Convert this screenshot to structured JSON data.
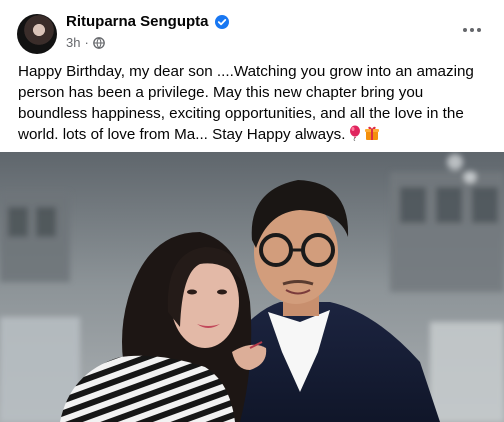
{
  "post": {
    "author": "Rituparna Sengupta",
    "time": "3h",
    "separator": "·",
    "verified": true,
    "icons": {
      "verified": "verified-badge-icon",
      "audience": "globe-icon",
      "more": "more-options-icon"
    },
    "text": "Happy Birthday, my dear son ....Watching you grow into an amazing person has been a privilege. May this new chapter bring you boundless happiness, exciting opportunities, and all the love in the world. lots of love from Ma... Stay Happy always.",
    "emojis": [
      "balloon",
      "gift"
    ],
    "photo": {
      "alt": "Woman in a striped top and a young man with glasses and a navy blazer posing together"
    },
    "colors": {
      "verified": "#1877f2",
      "meta": "#65676b",
      "text": "#050505"
    }
  }
}
